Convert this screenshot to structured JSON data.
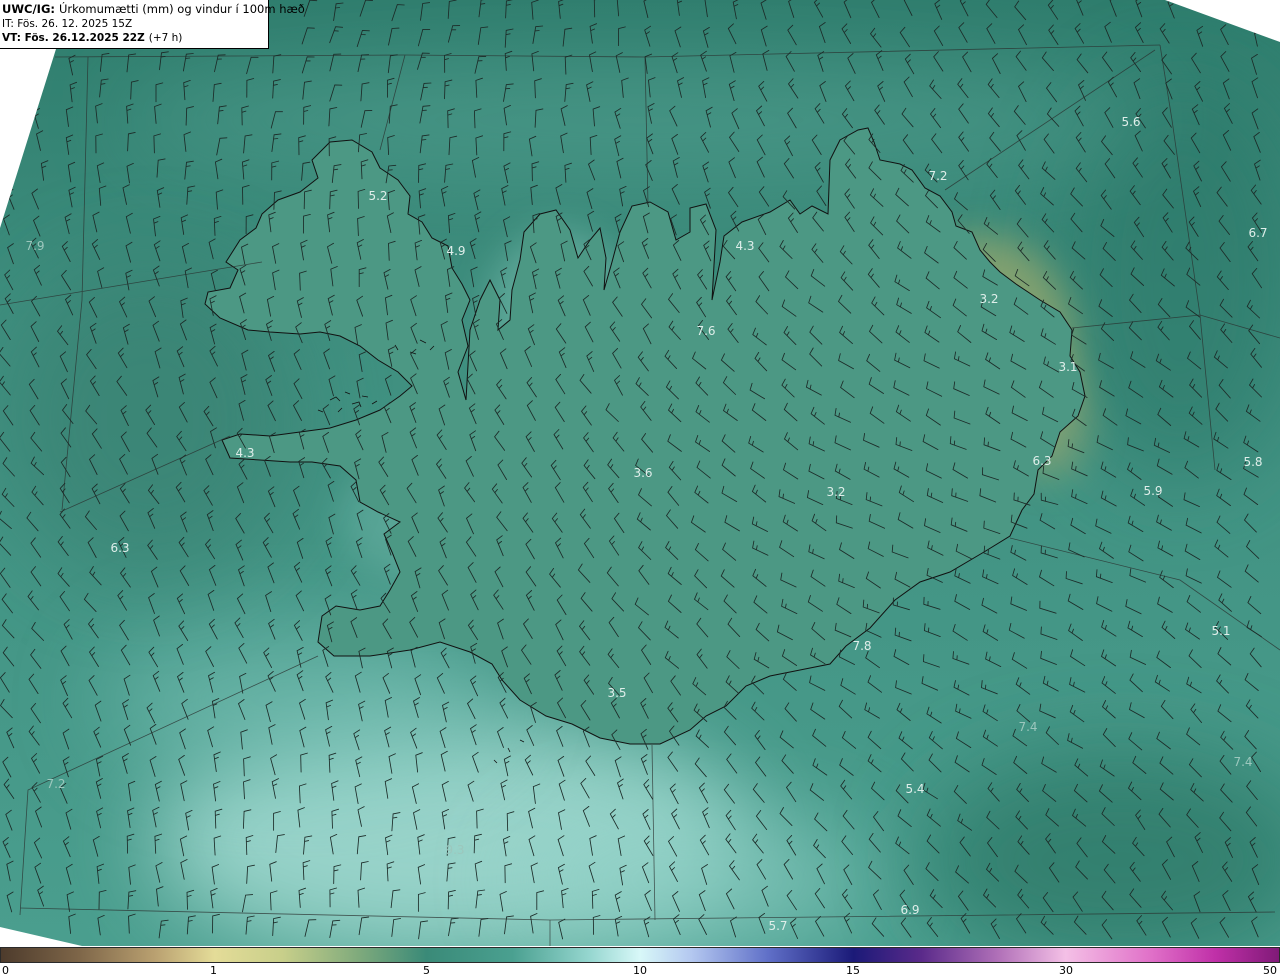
{
  "header": {
    "model": "UWC/IG:",
    "title": "Úrkomumætti (mm) og vindur í 100m hæð",
    "initial_time": "IT: Fös. 26. 12. 2025 15Z",
    "valid_time": "VT: Fös. 26.12.2025 22Z",
    "lead_time": "(+7 h)"
  },
  "map": {
    "value_labels": [
      "5.6",
      "7.2",
      "6.7",
      "5.2",
      "4.9",
      "4.3",
      "7.9",
      "3.2",
      "7.6",
      "3.1",
      "4.3",
      "3.6",
      "6.3",
      "5.8",
      "5.9",
      "3.2",
      "6.3",
      "5.1",
      "7.8",
      "3.5",
      "7.4",
      "7.4",
      "7.2",
      "5.4",
      "9.3",
      "6.9",
      "5.7"
    ],
    "icons": [
      "wind-barb-icon"
    ]
  },
  "colorbar": {
    "ticks": [
      "0",
      "1",
      "5",
      "10",
      "15",
      "30",
      "50"
    ]
  },
  "colors": {
    "ocean": "#3f8f7f",
    "land": "#4c9884",
    "glacier": "#a8ae72",
    "coastline": "#111111",
    "barb": "#1c2b28"
  }
}
